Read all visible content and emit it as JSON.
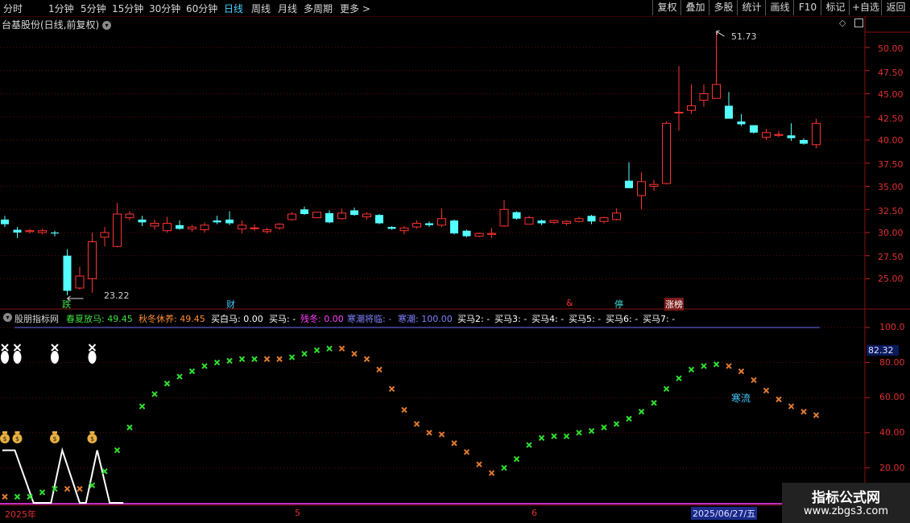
{
  "toolbar": {
    "timeframes": [
      "分时",
      "1分钟",
      "5分钟",
      "15分钟",
      "30分钟",
      "60分钟",
      "日线",
      "周线",
      "月线",
      "多周期",
      "更多 >"
    ],
    "active_timeframe": "日线",
    "buttons": [
      "复权",
      "叠加",
      "多股",
      "统计",
      "画线",
      "F10",
      "标记",
      "+自选",
      "返回"
    ]
  },
  "main_chart": {
    "title": "台基股份(日线,前复权)",
    "high_label": "51.73",
    "low_label": "23.22",
    "axis_ticks": [
      "50.00",
      "47.50",
      "45.00",
      "42.50",
      "40.00",
      "37.50",
      "35.00",
      "32.50",
      "30.00",
      "27.50",
      "25.00"
    ],
    "event_tags": [
      {
        "text": "跌",
        "color": "#40e040",
        "idx": 5
      },
      {
        "text": "财",
        "color": "#40c8ff",
        "idx": 18
      },
      {
        "text": "&",
        "color": "#ff3030",
        "idx": 45
      },
      {
        "text": "停",
        "color": "#40e0e0",
        "idx": 49
      },
      {
        "text": "涨榜",
        "color": "#ffffff",
        "idx": 53
      }
    ]
  },
  "indicator": {
    "title": "股朋指标网",
    "items": [
      {
        "text": "春夏放马: 49.45",
        "color": "#40e040"
      },
      {
        "text": "秋冬休养: 49.45",
        "color": "#ff8c30"
      },
      {
        "text": "买白马: 0.00",
        "color": "#ffffff"
      },
      {
        "text": "买马: -",
        "color": "#ffffff"
      },
      {
        "text": "残冬: 0.00",
        "color": "#ff40ff"
      },
      {
        "text": "寒潮将临: -",
        "color": "#8080ff"
      },
      {
        "text": "寒潮: 100.00",
        "color": "#8080ff"
      },
      {
        "text": "买马2: -",
        "color": "#ffffff"
      },
      {
        "text": "买马3: -",
        "color": "#ffffff"
      },
      {
        "text": "买马4: -",
        "color": "#ffffff"
      },
      {
        "text": "买马5: -",
        "color": "#ffffff"
      },
      {
        "text": "买马6: -",
        "color": "#ffffff"
      },
      {
        "text": "买马7: -",
        "color": "#ffffff"
      }
    ],
    "axis_ticks": [
      "100.0",
      "80.00",
      "60.00",
      "40.00",
      "20.00"
    ],
    "current_value": "82.32",
    "annotation": "寒流"
  },
  "x_axis": {
    "labels": [
      "2025年",
      "5",
      "6"
    ],
    "cursor_date": "2025/06/27/五"
  },
  "watermark": {
    "line1": "指标公式网",
    "line2": "www.zbgs3.com"
  },
  "chart_data": [
    {
      "type": "candlestick",
      "title": "台基股份(日线,前复权)",
      "ylim": [
        23,
        52.5
      ],
      "ohlc": [
        [
          31.4,
          31.8,
          30.6,
          30.9
        ],
        [
          30.3,
          30.6,
          29.4,
          30.0
        ],
        [
          30.1,
          30.4,
          29.9,
          30.2
        ],
        [
          30.0,
          30.4,
          29.8,
          30.2
        ],
        [
          30.0,
          30.2,
          29.6,
          29.9
        ],
        [
          27.5,
          28.2,
          23.22,
          23.7
        ],
        [
          24.0,
          26.3,
          23.8,
          25.3
        ],
        [
          25.0,
          30.0,
          23.5,
          29.0
        ],
        [
          29.5,
          30.6,
          28.5,
          30.0
        ],
        [
          28.5,
          33.2,
          28.4,
          32.0
        ],
        [
          31.6,
          32.3,
          31.3,
          32.0
        ],
        [
          31.4,
          31.8,
          30.7,
          31.1
        ],
        [
          30.7,
          31.4,
          30.3,
          31.0
        ],
        [
          30.2,
          31.7,
          30.0,
          31.0
        ],
        [
          30.8,
          31.3,
          30.3,
          30.4
        ],
        [
          30.4,
          30.8,
          30.1,
          30.6
        ],
        [
          30.3,
          31.1,
          30.0,
          30.8
        ],
        [
          31.3,
          31.8,
          30.9,
          31.1
        ],
        [
          31.4,
          32.3,
          30.8,
          31.0
        ],
        [
          30.4,
          31.3,
          29.9,
          30.8
        ],
        [
          30.5,
          30.9,
          30.2,
          30.5
        ],
        [
          30.1,
          30.5,
          29.9,
          30.3
        ],
        [
          30.5,
          31.0,
          30.3,
          30.9
        ],
        [
          31.4,
          32.2,
          31.3,
          32.0
        ],
        [
          32.5,
          32.8,
          31.9,
          32.0
        ],
        [
          31.6,
          32.2,
          31.6,
          32.2
        ],
        [
          32.1,
          32.4,
          31.0,
          31.1
        ],
        [
          31.5,
          32.6,
          31.4,
          32.1
        ],
        [
          32.4,
          32.7,
          31.8,
          31.9
        ],
        [
          31.7,
          32.2,
          31.4,
          32.0
        ],
        [
          31.9,
          32.0,
          30.9,
          31.0
        ],
        [
          30.6,
          30.7,
          30.3,
          30.4
        ],
        [
          30.2,
          30.7,
          29.8,
          30.5
        ],
        [
          30.6,
          31.3,
          30.4,
          31.0
        ],
        [
          31.0,
          31.2,
          30.6,
          30.8
        ],
        [
          30.8,
          32.6,
          30.6,
          31.5
        ],
        [
          31.3,
          31.4,
          29.8,
          29.9
        ],
        [
          30.2,
          30.3,
          29.5,
          29.6
        ],
        [
          29.6,
          30.0,
          29.5,
          29.9
        ],
        [
          29.8,
          30.5,
          29.4,
          29.9
        ],
        [
          30.7,
          33.5,
          30.6,
          32.5
        ],
        [
          32.2,
          32.3,
          31.4,
          31.5
        ],
        [
          30.9,
          31.8,
          30.9,
          31.6
        ],
        [
          31.3,
          31.4,
          30.8,
          31.0
        ],
        [
          31.1,
          31.4,
          30.9,
          31.3
        ],
        [
          31.0,
          31.3,
          30.8,
          31.2
        ],
        [
          31.2,
          31.7,
          31.1,
          31.5
        ],
        [
          31.8,
          31.9,
          30.9,
          31.2
        ],
        [
          31.2,
          31.7,
          31.0,
          31.6
        ],
        [
          31.4,
          32.6,
          31.3,
          32.1
        ],
        [
          35.6,
          37.6,
          34.8,
          34.8
        ],
        [
          34.0,
          36.5,
          32.5,
          35.5
        ],
        [
          35.0,
          35.7,
          34.5,
          35.2
        ],
        [
          35.3,
          42.0,
          35.2,
          41.8
        ],
        [
          43.0,
          48.0,
          41.0,
          43.0
        ],
        [
          43.2,
          46.0,
          42.8,
          43.7
        ],
        [
          44.3,
          46.0,
          43.6,
          45.0
        ],
        [
          44.5,
          51.73,
          44.5,
          46.0
        ],
        [
          43.7,
          45.2,
          42.4,
          42.3
        ],
        [
          42.0,
          42.8,
          41.5,
          41.7
        ],
        [
          41.6,
          41.6,
          40.7,
          40.8
        ],
        [
          40.3,
          41.2,
          40.0,
          40.8
        ],
        [
          40.5,
          41.0,
          40.3,
          40.6
        ],
        [
          40.5,
          41.8,
          39.9,
          40.2
        ],
        [
          40.0,
          40.2,
          39.5,
          39.6
        ],
        [
          39.5,
          42.3,
          39.1,
          41.8
        ]
      ]
    },
    {
      "type": "scatter",
      "title": "股朋指标网",
      "ylim": [
        0,
        105
      ],
      "ticks": [
        100,
        80,
        60,
        40,
        20
      ],
      "cross_points": [
        [
          0,
          3.5,
          "o"
        ],
        [
          1,
          3.5,
          "g"
        ],
        [
          2,
          3.5,
          "g"
        ],
        [
          3,
          6,
          "g"
        ],
        [
          4,
          8,
          "g"
        ],
        [
          5,
          8,
          "o"
        ],
        [
          6,
          8,
          "o"
        ],
        [
          7,
          10,
          "g"
        ],
        [
          8,
          18,
          "g"
        ],
        [
          9,
          30,
          "g"
        ],
        [
          10,
          43,
          "g"
        ],
        [
          11,
          55,
          "g"
        ],
        [
          12,
          62,
          "g"
        ],
        [
          13,
          68,
          "g"
        ],
        [
          14,
          72,
          "g"
        ],
        [
          15,
          75,
          "g"
        ],
        [
          16,
          78,
          "g"
        ],
        [
          17,
          80,
          "g"
        ],
        [
          18,
          81,
          "g"
        ],
        [
          19,
          82,
          "g"
        ],
        [
          20,
          82,
          "g"
        ],
        [
          21,
          82,
          "o"
        ],
        [
          22,
          82,
          "o"
        ],
        [
          23,
          83,
          "g"
        ],
        [
          24,
          85,
          "g"
        ],
        [
          25,
          87,
          "g"
        ],
        [
          26,
          88,
          "g"
        ],
        [
          27,
          88,
          "o"
        ],
        [
          28,
          85,
          "o"
        ],
        [
          29,
          82,
          "o"
        ],
        [
          30,
          76,
          "o"
        ],
        [
          31,
          65,
          "o"
        ],
        [
          32,
          53,
          "o"
        ],
        [
          33,
          45,
          "o"
        ],
        [
          34,
          40,
          "o"
        ],
        [
          35,
          39,
          "o"
        ],
        [
          36,
          34,
          "o"
        ],
        [
          37,
          29,
          "o"
        ],
        [
          38,
          22,
          "o"
        ],
        [
          39,
          17,
          "o"
        ],
        [
          40,
          20,
          "g"
        ],
        [
          41,
          25,
          "g"
        ],
        [
          42,
          33,
          "g"
        ],
        [
          43,
          37,
          "g"
        ],
        [
          44,
          38,
          "g"
        ],
        [
          45,
          38,
          "g"
        ],
        [
          46,
          40,
          "g"
        ],
        [
          47,
          41,
          "g"
        ],
        [
          48,
          43,
          "g"
        ],
        [
          49,
          45,
          "g"
        ],
        [
          50,
          48,
          "g"
        ],
        [
          51,
          52,
          "g"
        ],
        [
          52,
          57,
          "g"
        ],
        [
          53,
          65,
          "g"
        ],
        [
          54,
          71,
          "g"
        ],
        [
          55,
          76,
          "g"
        ],
        [
          56,
          78,
          "g"
        ],
        [
          57,
          79,
          "g"
        ],
        [
          58,
          78,
          "o"
        ],
        [
          59,
          75,
          "o"
        ],
        [
          60,
          70,
          "o"
        ],
        [
          61,
          64,
          "o"
        ],
        [
          62,
          59,
          "o"
        ],
        [
          63,
          55,
          "o"
        ],
        [
          64,
          52,
          "o"
        ],
        [
          65,
          50,
          "o"
        ]
      ],
      "white_line": [
        [
          -0.2,
          30
        ],
        [
          0.8,
          30
        ],
        [
          2.3,
          0
        ],
        [
          3.7,
          0
        ],
        [
          4.6,
          30
        ],
        [
          6.0,
          0
        ],
        [
          6.5,
          0
        ],
        [
          7.4,
          30
        ],
        [
          8.4,
          0
        ],
        [
          9.5,
          0
        ]
      ],
      "horse_icons": [
        0,
        1,
        4,
        7
      ],
      "money_icons": [
        0,
        1,
        4,
        7
      ],
      "cold_line_value": 100
    }
  ]
}
